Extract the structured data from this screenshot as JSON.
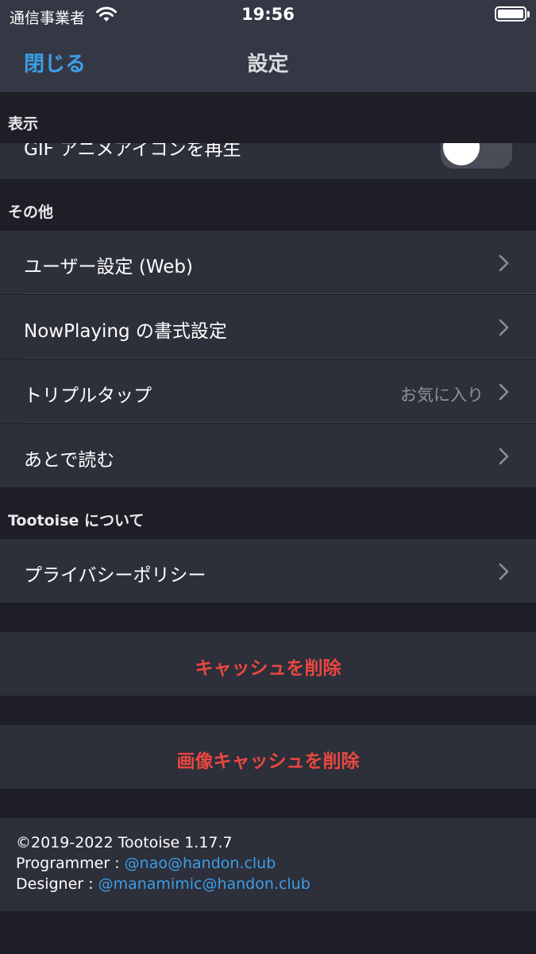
{
  "status": {
    "carrier": "通信事業者",
    "time": "19:56"
  },
  "nav": {
    "close_label": "閉じる",
    "title": "設定"
  },
  "sections": {
    "display": {
      "header": "表示",
      "gif_label": "GIF アニメアイコンを再生",
      "gif_toggle_on": false
    },
    "other": {
      "header": "その他",
      "items": [
        {
          "label": "ユーザー設定 (Web)",
          "value": ""
        },
        {
          "label": "NowPlaying の書式設定",
          "value": ""
        },
        {
          "label": "トリプルタップ",
          "value": "お気に入り"
        },
        {
          "label": "あとで読む",
          "value": ""
        }
      ]
    },
    "about": {
      "header": "Tootoise について",
      "items": [
        {
          "label": "プライバシーポリシー"
        }
      ]
    }
  },
  "actions": {
    "clear_cache": "キャッシュを削除",
    "clear_image_cache": "画像キャッシュを削除"
  },
  "footer": {
    "copyright": "©2019-2022 Tootoise 1.17.7",
    "programmer_label": "Programmer : ",
    "programmer_link": "@nao@handon.club",
    "designer_label": "Designer : ",
    "designer_link": "@manamimic@handon.club"
  },
  "colors": {
    "accent": "#3d9ee8",
    "destructive": "#e9483f",
    "background": "#1e1f26",
    "cell": "#2d2f3a",
    "navbar": "#343845"
  }
}
